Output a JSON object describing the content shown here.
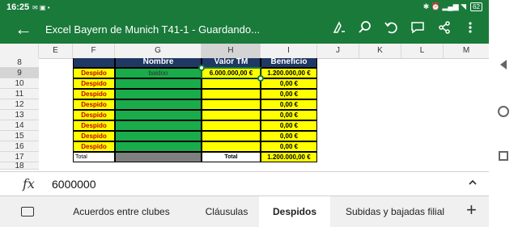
{
  "status": {
    "time": "16:25",
    "left_icons": "✉ ▣ •",
    "right_icons": "✱ ⏰ ▂▄▆ ◥",
    "battery": "62"
  },
  "app": {
    "title": "Excel Bayern de Munich T41-1 - Guardando..."
  },
  "toolbar": {
    "back_icon": "arrow-left-icon",
    "icons": [
      "draw-pen-icon",
      "search-icon",
      "undo-icon",
      "comment-icon",
      "share-icon",
      "more-vertical-icon"
    ]
  },
  "columns": [
    "E",
    "F",
    "G",
    "H",
    "I",
    "J",
    "K",
    "L",
    "M"
  ],
  "selected_column": "H",
  "rows": [
    "8",
    "9",
    "10",
    "11",
    "12",
    "13",
    "14",
    "15",
    "16",
    "17",
    "18"
  ],
  "selected_row": "9",
  "table": {
    "headers": [
      "Nombre",
      "Valor TM",
      "Beneficio"
    ],
    "rows": [
      {
        "label": "Despido",
        "name": "baidoo",
        "valor": "6.000.000,00 €",
        "beneficio": "1.200.000,00 €"
      },
      {
        "label": "Despido",
        "name": "",
        "valor": "",
        "beneficio": "0,00 €"
      },
      {
        "label": "Despido",
        "name": "",
        "valor": "",
        "beneficio": "0,00 €"
      },
      {
        "label": "Despido",
        "name": "",
        "valor": "",
        "beneficio": "0,00 €"
      },
      {
        "label": "Despido",
        "name": "",
        "valor": "",
        "beneficio": "0,00 €"
      },
      {
        "label": "Despido",
        "name": "",
        "valor": "",
        "beneficio": "0,00 €"
      },
      {
        "label": "Despido",
        "name": "",
        "valor": "",
        "beneficio": "0,00 €"
      },
      {
        "label": "Despido",
        "name": "",
        "valor": "",
        "beneficio": "0,00 €"
      }
    ],
    "total_row": {
      "label": "Total",
      "valor_label": "Total",
      "beneficio": "1.200.000,00 €"
    }
  },
  "formula_bar": {
    "fx": "fx",
    "value": "6000000"
  },
  "sheet_tabs": [
    {
      "label": "Acuerdos entre clubes",
      "active": false
    },
    {
      "label": "Cláusulas",
      "active": false
    },
    {
      "label": "Despidos",
      "active": true
    },
    {
      "label": "Subidas y bajadas filial",
      "active": false
    }
  ],
  "colors": {
    "accent": "#1a7a3a",
    "header_fill": "#1f3864",
    "yellow": "#ffff00",
    "green": "#1aab4a",
    "red_text": "#c00000"
  }
}
